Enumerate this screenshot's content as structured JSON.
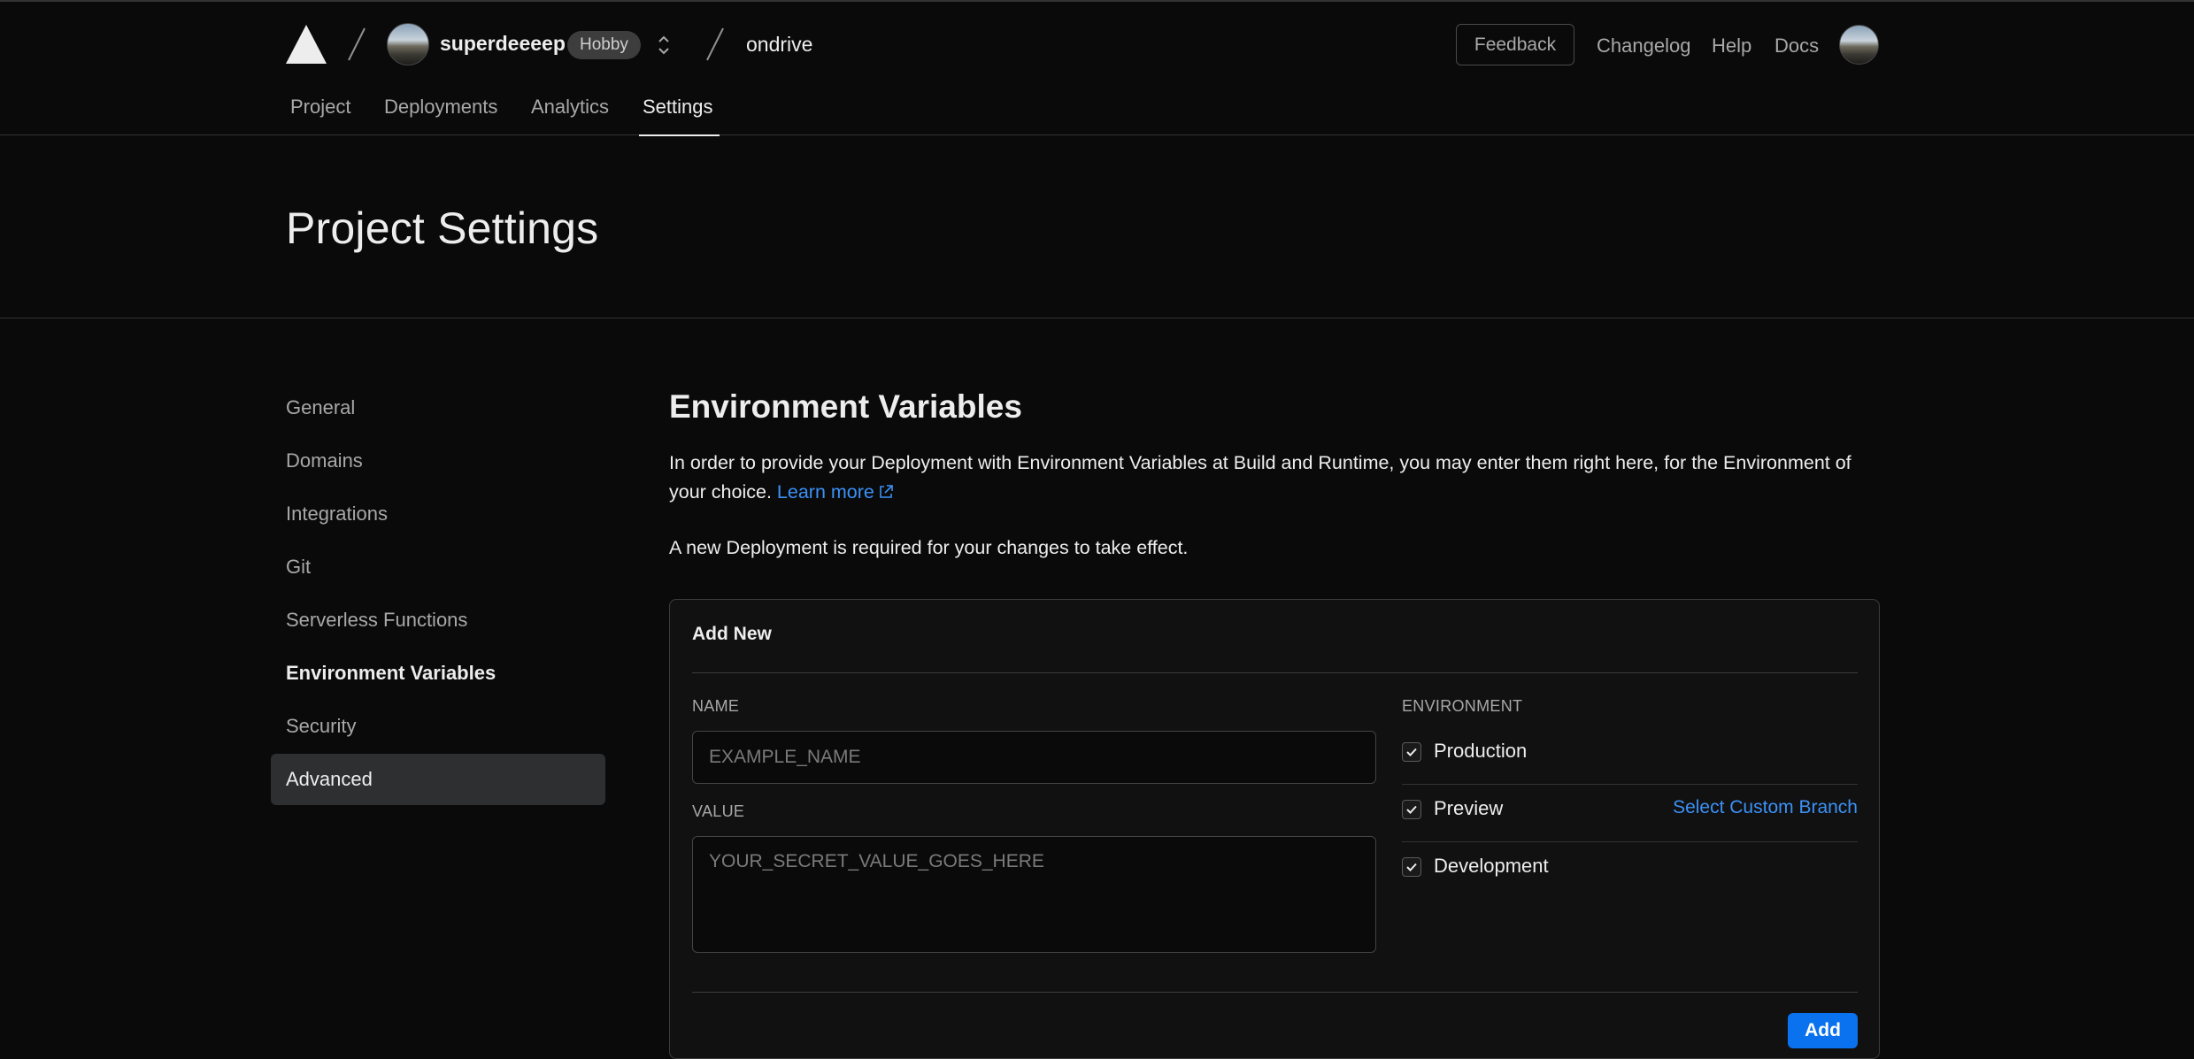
{
  "header": {
    "team": {
      "name": "superdeeeep",
      "plan_badge": "Hobby"
    },
    "project": {
      "name": "ondrive"
    },
    "right_links": {
      "feedback": "Feedback",
      "changelog": "Changelog",
      "help": "Help",
      "docs": "Docs"
    }
  },
  "tabs": [
    {
      "label": "Project"
    },
    {
      "label": "Deployments"
    },
    {
      "label": "Analytics"
    },
    {
      "label": "Settings",
      "active": true
    }
  ],
  "page": {
    "title": "Project Settings"
  },
  "sidebar": {
    "items": [
      {
        "label": "General"
      },
      {
        "label": "Domains"
      },
      {
        "label": "Integrations"
      },
      {
        "label": "Git"
      },
      {
        "label": "Serverless Functions"
      },
      {
        "label": "Environment Variables",
        "active": true
      },
      {
        "label": "Security"
      },
      {
        "label": "Advanced",
        "highlighted": true
      }
    ]
  },
  "main": {
    "title": "Environment Variables",
    "description": "In order to provide your Deployment with Environment Variables at Build and Runtime, you may enter them right here, for the Environment of your choice.",
    "learn_more": "Learn more",
    "note": "A new Deployment is required for your changes to take effect."
  },
  "add_new": {
    "title": "Add New",
    "name_label": "NAME",
    "name_placeholder": "EXAMPLE_NAME",
    "name_value": "",
    "value_label": "VALUE",
    "value_placeholder": "YOUR_SECRET_VALUE_GOES_HERE",
    "value_value": "",
    "environment_label": "ENVIRONMENT",
    "environments": [
      {
        "label": "Production",
        "checked": true
      },
      {
        "label": "Preview",
        "checked": true,
        "action": "Select Custom Branch"
      },
      {
        "label": "Development",
        "checked": true
      }
    ],
    "add_button": "Add"
  },
  "colors": {
    "background": "#0a0a0a",
    "link": "#3b91f7",
    "primary_button": "#0a72ef",
    "selected_item": "#2e2f30"
  }
}
